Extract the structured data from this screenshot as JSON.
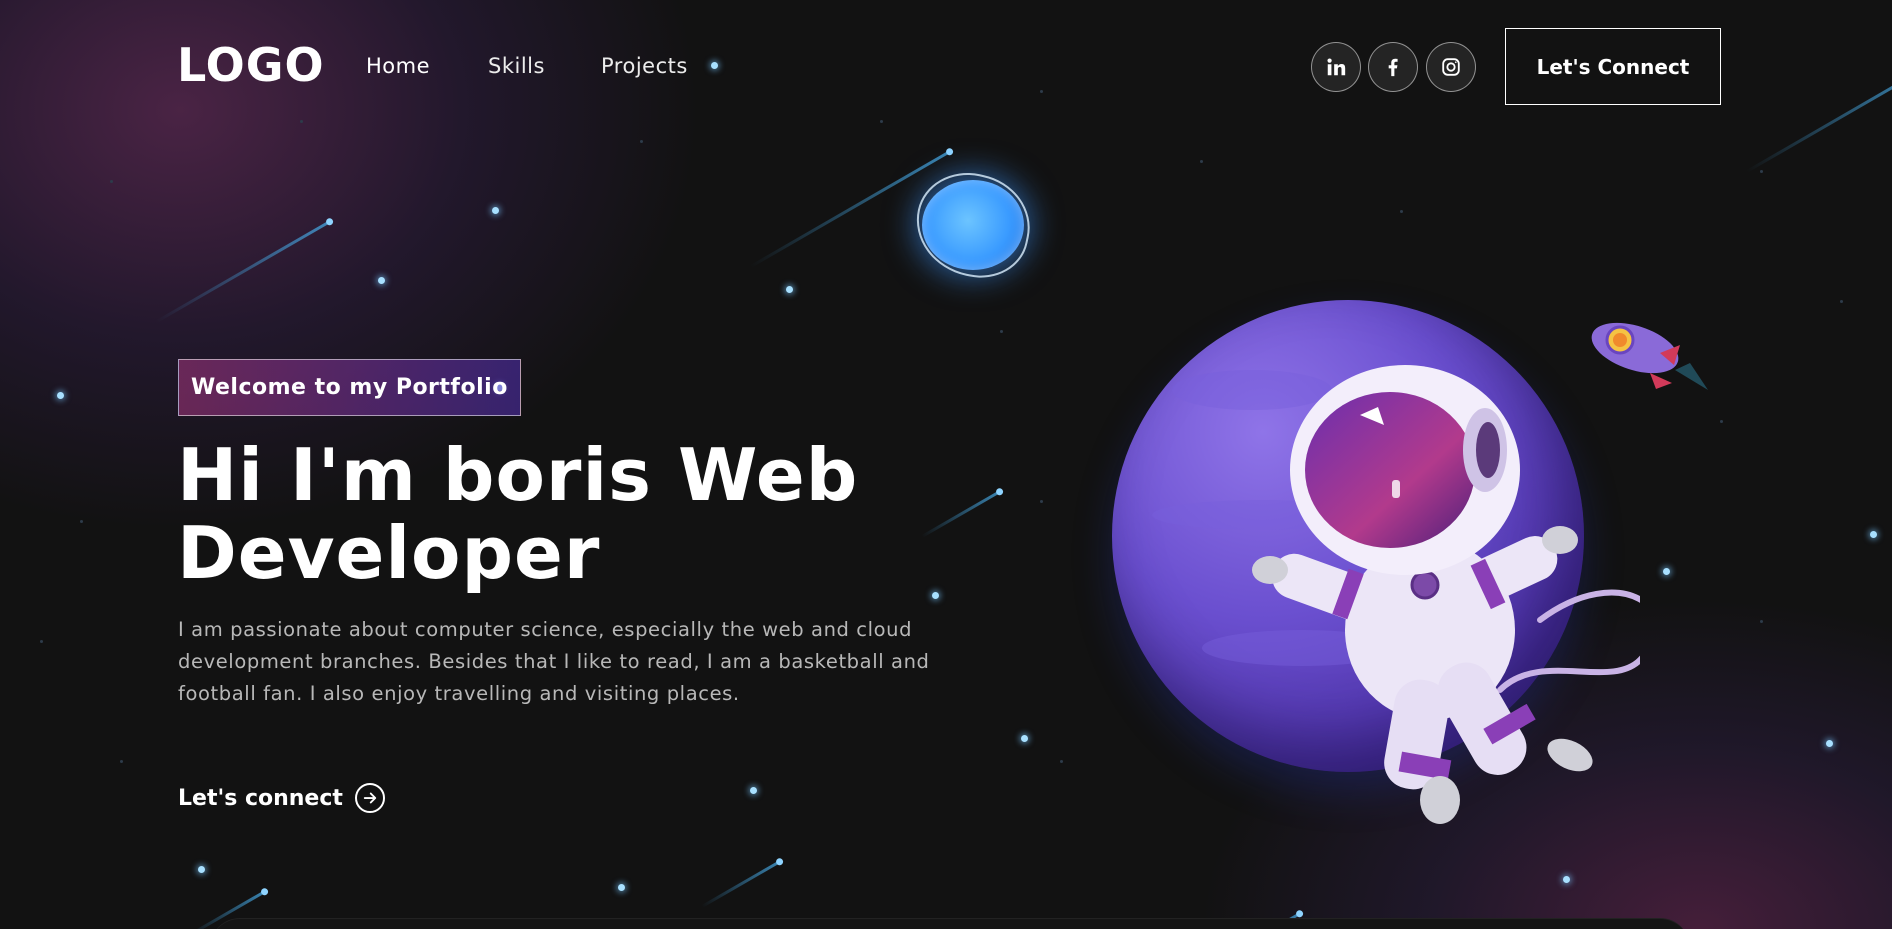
{
  "navbar": {
    "logo": "LOGO",
    "links": [
      {
        "label": "Home",
        "active": true
      },
      {
        "label": "Skills",
        "active": false
      },
      {
        "label": "Projects",
        "active": false
      }
    ],
    "social_icons": [
      "linkedin-icon",
      "facebook-icon",
      "instagram-icon"
    ],
    "connect_button": "Let's Connect"
  },
  "hero": {
    "tagline": "Welcome to my Portfolio",
    "headline": "Hi I'm boris Web Developer",
    "bio": "I am passionate about computer science, especially the web and cloud development branches. Besides that I like to read, I am a basketball and football fan. I also enjoy travelling and visiting places.",
    "connect_link": "Let's connect"
  },
  "colors": {
    "background": "#121212",
    "tagline_gradient_start": "#aa367c",
    "tagline_gradient_end": "#4a2fbd",
    "text_primary": "#ffffff",
    "text_secondary": "#b8b8b8",
    "planet_purple": "#6a4fcf",
    "planet_blue": "#3a9bff"
  }
}
